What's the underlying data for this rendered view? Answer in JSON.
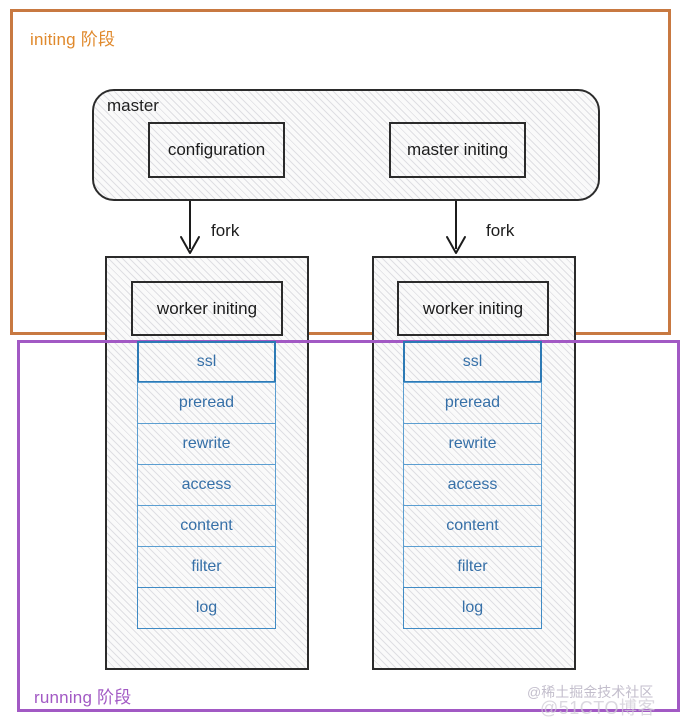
{
  "phases": {
    "initing": {
      "label": "initing 阶段",
      "color": "#e0892c",
      "border_color": "#c87941"
    },
    "running": {
      "label": "running 阶段",
      "color": "#a259c4",
      "border_color": "#a259c4"
    }
  },
  "master": {
    "title": "master",
    "boxes": [
      {
        "label": "configuration"
      },
      {
        "label": "master initing"
      }
    ]
  },
  "fork": {
    "left_label": "fork",
    "right_label": "fork"
  },
  "workers": [
    {
      "initing_label": "worker initing",
      "phase_items": [
        {
          "label": "ssl"
        },
        {
          "label": "preread"
        },
        {
          "label": "rewrite"
        },
        {
          "label": "access"
        },
        {
          "label": "content"
        },
        {
          "label": "filter"
        },
        {
          "label": "log"
        }
      ]
    },
    {
      "initing_label": "worker initing",
      "phase_items": [
        {
          "label": "ssl"
        },
        {
          "label": "preread"
        },
        {
          "label": "rewrite"
        },
        {
          "label": "access"
        },
        {
          "label": "content"
        },
        {
          "label": "filter"
        },
        {
          "label": "log"
        }
      ]
    }
  ],
  "watermarks": {
    "juejin": "@稀土掘金技术社区",
    "cto": "@51CTO博客"
  },
  "colors": {
    "phase_item_text": "#3670a8",
    "phase_item_border": "#5b9ed1",
    "box_border": "#2b2b2b",
    "hatch": "#a0a0af"
  }
}
